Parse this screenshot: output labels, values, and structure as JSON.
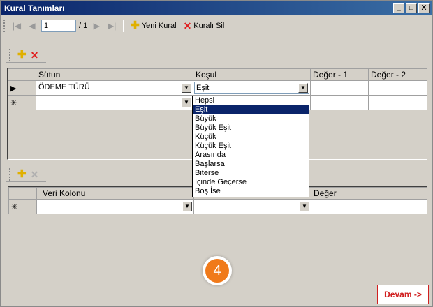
{
  "window": {
    "title": "Kural Tanımları",
    "min": "_",
    "max": "□",
    "close": "X"
  },
  "toolbar": {
    "page_value": "1",
    "page_total": "/ 1",
    "new_rule": "Yeni Kural",
    "delete_rule": "Kuralı Sil"
  },
  "rules_grid": {
    "columns": [
      "",
      "Sütun",
      "Koşul",
      "Değer - 1",
      "Değer - 2"
    ],
    "rows": [
      {
        "marker": "▶",
        "sutun": "ÖDEME TÜRÜ",
        "kosul": "Eşit",
        "deger1": "",
        "deger2": ""
      },
      {
        "marker": "✳",
        "sutun": "",
        "kosul": "",
        "deger1": "",
        "deger2": ""
      }
    ]
  },
  "condition_dropdown": {
    "options": [
      "Hepsi",
      "Eşit",
      "Büyük",
      "Büyük Eşit",
      "Küçük",
      "Küçük Eşit",
      "Arasında",
      "Başlarsa",
      "Biterse",
      "İçinde Geçerse",
      "Boş İse"
    ],
    "selected_index": 1
  },
  "values_grid": {
    "columns": [
      "",
      "Veri Kolonu",
      "",
      "Değer"
    ],
    "rows": [
      {
        "marker": "✳"
      }
    ]
  },
  "step_badge": "4",
  "continue_button": "Devam ->",
  "colors": {
    "titlebar": "#0a246a",
    "selection": "#0a246a",
    "accent": "#d02020",
    "badge": "#f07a1a"
  }
}
